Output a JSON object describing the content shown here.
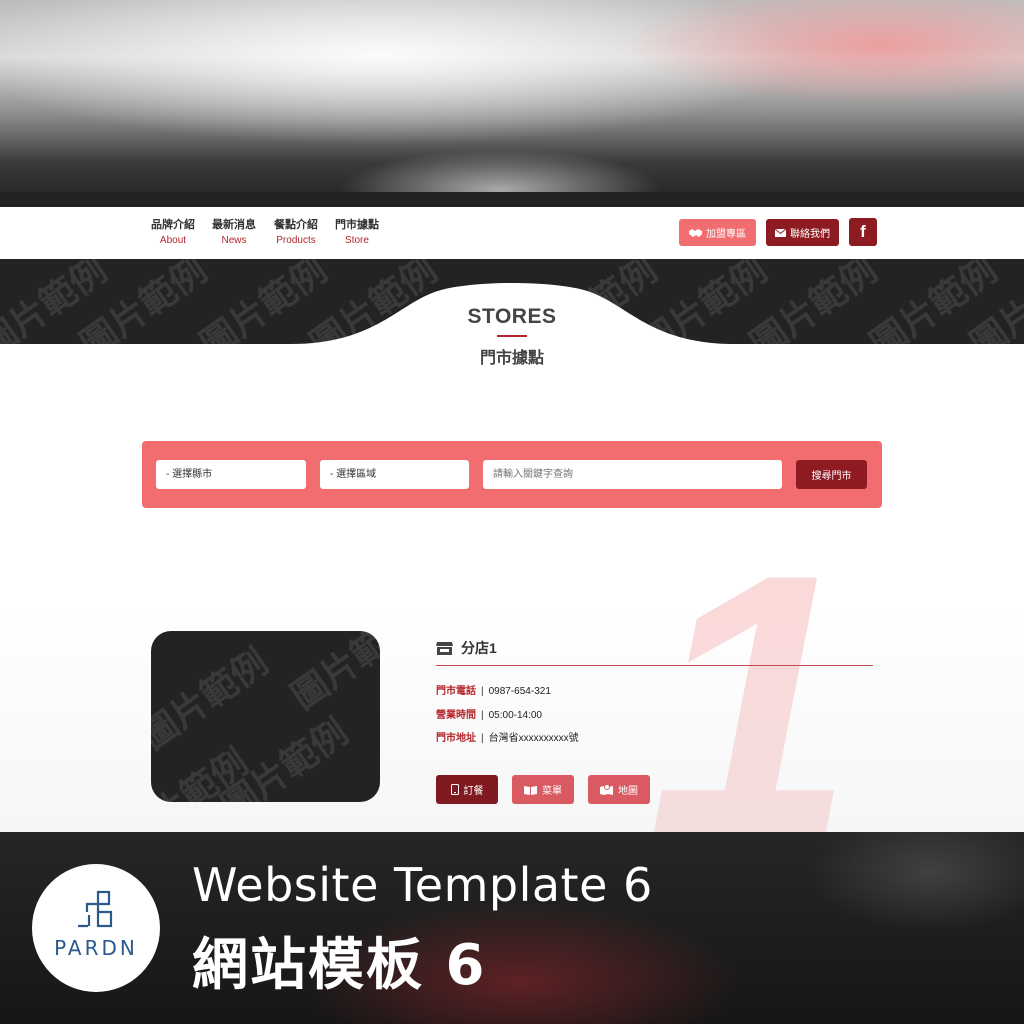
{
  "nav": {
    "items": [
      {
        "zh": "品牌介紹",
        "en": "About"
      },
      {
        "zh": "最新消息",
        "en": "News"
      },
      {
        "zh": "餐點介紹",
        "en": "Products"
      },
      {
        "zh": "門市據點",
        "en": "Store"
      }
    ],
    "franchise_label": "加盟專區",
    "contact_label": "聯絡我們",
    "facebook_label": "f"
  },
  "watermark_text": "圖片範例",
  "page": {
    "title": "STORES",
    "subtitle": "門市據點"
  },
  "search": {
    "county_selected": "- 選擇縣市",
    "district_selected": "- 選擇區域",
    "keyword_placeholder": "請輸入關鍵字查詢",
    "button_label": "搜尋門市"
  },
  "store": {
    "index": "1",
    "name": "分店1",
    "phone_label": "門市電話",
    "phone": "0987-654-321",
    "hours_label": "營業時間",
    "hours": "05:00-14:00",
    "address_label": "門市地址",
    "address": "台灣省xxxxxxxxxx號",
    "separator": "|",
    "order_label": "訂餐",
    "menu_label": "菜單",
    "map_label": "地圖"
  },
  "banner": {
    "logo_text": "PARDN",
    "title_en": "Website Template 6",
    "title_zh": "網站模板 6"
  },
  "colors": {
    "brand_red": "#8e1b22",
    "coral": "#f26d70",
    "dark": "#232323"
  }
}
